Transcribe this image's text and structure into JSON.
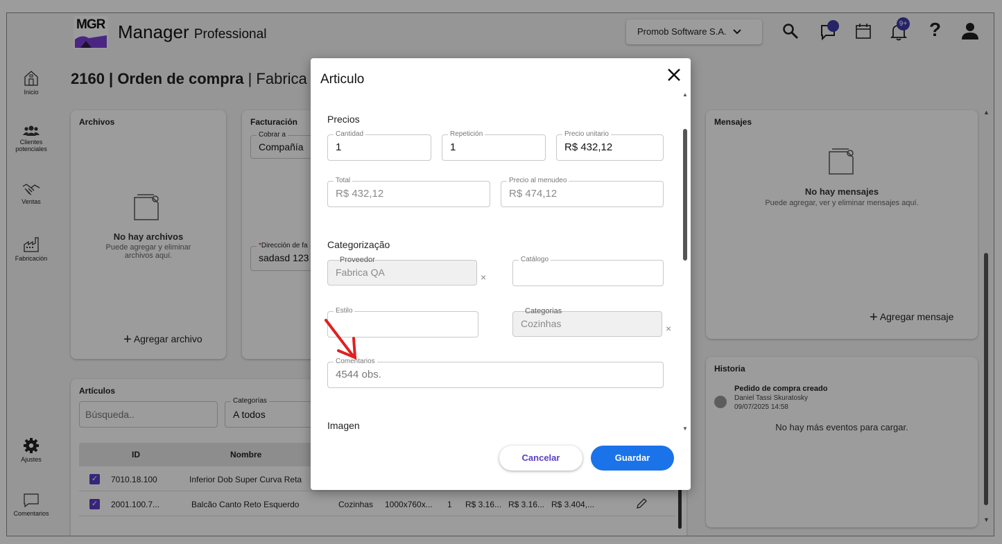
{
  "header": {
    "logo_text": "MGR",
    "app_title": "Manager",
    "app_subtitle": "Professional",
    "company": "Promob Software S.A.",
    "messages_badge": "",
    "notifications_badge": "9+"
  },
  "sidebar": {
    "items": [
      {
        "label": "Inicio",
        "icon": "home-icon"
      },
      {
        "label": "Clientes potenciales",
        "icon": "people-icon"
      },
      {
        "label": "Ventas",
        "icon": "handshake-icon"
      },
      {
        "label": "Fabricación",
        "icon": "factory-icon"
      }
    ],
    "bottom": [
      {
        "label": "Ajustes",
        "icon": "gear-icon"
      },
      {
        "label": "Comentarios",
        "icon": "comment-icon"
      }
    ]
  },
  "page": {
    "title_bold": "2160 | Orden de compra",
    "title_rest": " | Fabrica QA"
  },
  "files": {
    "title": "Archivos",
    "empty_title": "No hay archivos",
    "empty_text": "Puede agregar y eliminar archivos aquí.",
    "add_label": "Agregar archivo"
  },
  "billing": {
    "title": "Facturación",
    "charge_legend": "Cobrar a",
    "charge_value": "Compañía",
    "address_legend": "Dirección de fa",
    "address_value": "sadasd 123"
  },
  "messages": {
    "title": "Mensajes",
    "empty_title": "No hay mensajes",
    "empty_text": "Puede agregar, ver y eliminar mensajes aquí.",
    "add_label": "Agregar mensaje"
  },
  "history": {
    "title": "Historia",
    "event_title": "Pedido de compra creado",
    "event_user": "Daniel Tassi Skuratosky",
    "event_date": "09/07/2025 14:58",
    "no_more": "No hay más eventos para cargar."
  },
  "articles": {
    "title": "Artículos",
    "search_placeholder": "Búsqueda..",
    "category_legend": "Categorías",
    "category_value": "A todos",
    "columns": [
      "ID",
      "Nombre"
    ],
    "rows": [
      {
        "id": "7010.18.100",
        "name": "Inferior Dob Super Curva Reta",
        "cat": "",
        "dims": "",
        "qty": "",
        "p1": "",
        "p2": "",
        "p3": ""
      },
      {
        "id": "2001.100.7...",
        "name": "Balcão Canto Reto Esquerdo",
        "cat": "Cozinhas",
        "dims": "1000x760x...",
        "qty": "1",
        "p1": "R$ 3.16...",
        "p2": "R$ 3.16...",
        "p3": "R$ 3.404,..."
      }
    ]
  },
  "modal": {
    "title": "Articulo",
    "prices_section": "Precios",
    "quantity_legend": "Cantidad",
    "quantity_value": "1",
    "repeat_legend": "Repetición",
    "repeat_value": "1",
    "unit_price_legend": "Precio unitario",
    "unit_price_value": "R$ 432,12",
    "total_legend": "Total",
    "total_value": "R$ 432,12",
    "retail_legend": "Precio al menudeo",
    "retail_value": "R$ 474,12",
    "categorization_section": "Categorização",
    "supplier_legend": "Proveedor",
    "supplier_value": "Fabrica QA",
    "catalog_legend": "Catálogo",
    "catalog_value": "",
    "style_legend": "Estilo",
    "style_value": "",
    "categories_legend": "Categorias",
    "categories_value": "Cozinhas",
    "comments_legend": "Comentarios",
    "comments_value": "4544 obs.",
    "image_section": "Imagen",
    "cancel_label": "Cancelar",
    "save_label": "Guardar"
  },
  "colors": {
    "primary": "#1a73e8",
    "cancel_text": "#5b3fc4",
    "checkbox": "#5b3fc4",
    "arrow": "#e02020"
  }
}
